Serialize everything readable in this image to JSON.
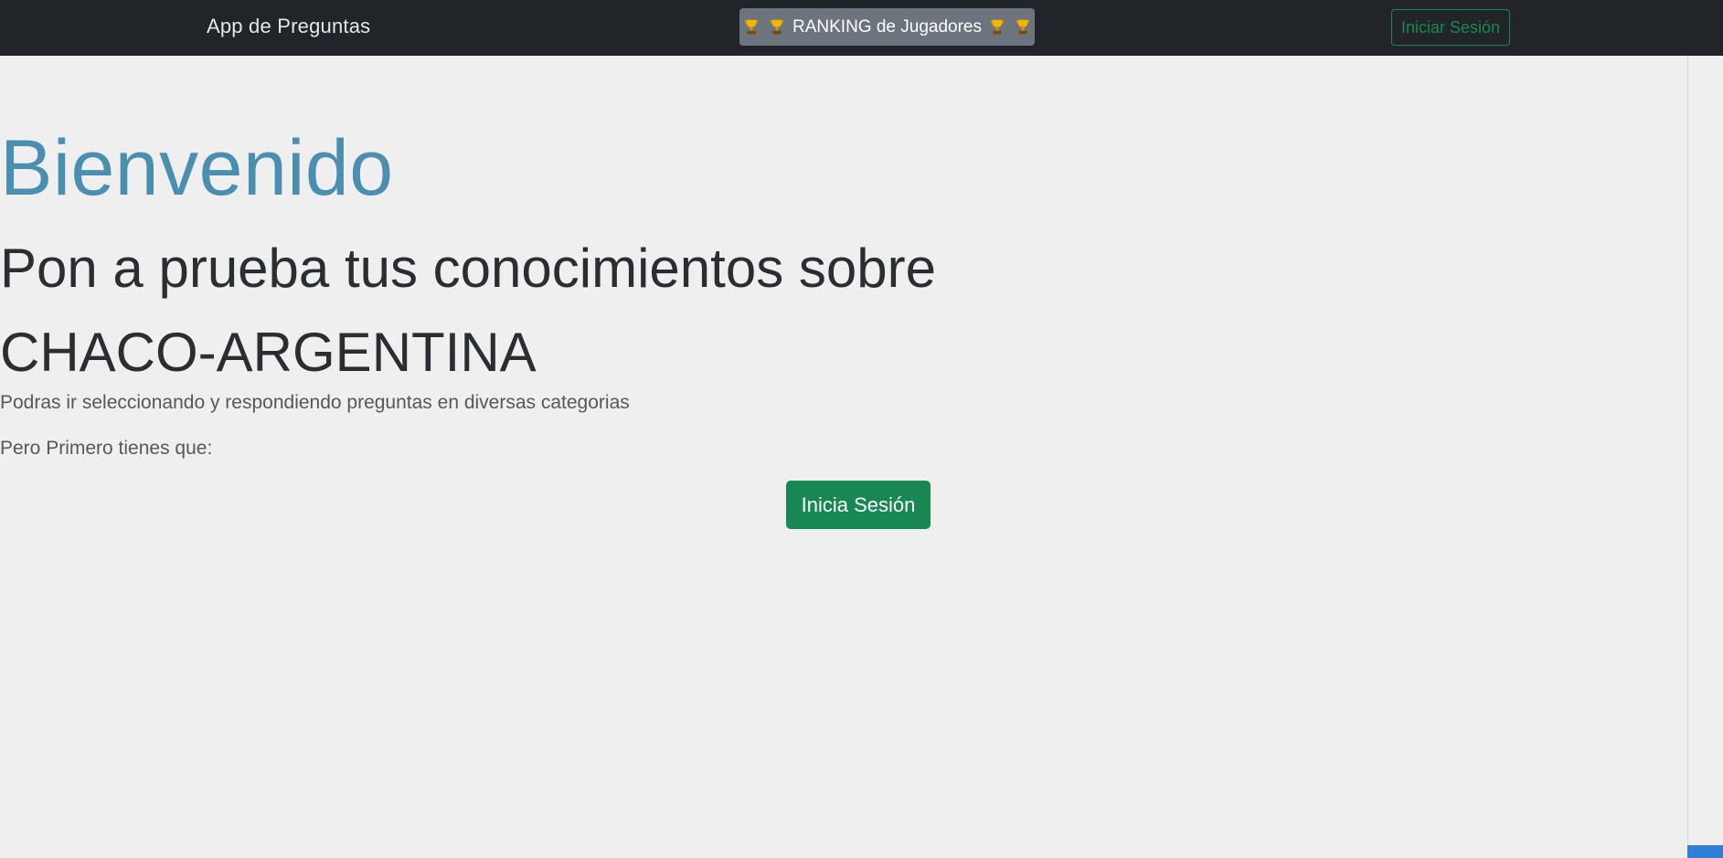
{
  "navbar": {
    "brand": "App de Preguntas",
    "ranking_label": "RANKING de Jugadores",
    "login_label": "Iniciar Sesión"
  },
  "hero": {
    "title": "Bienvenido",
    "subtitle_line1": "Pon a prueba tus conocimientos sobre",
    "subtitle_line2": "CHACO-ARGENTINA",
    "description": "Podras ir seleccionando y respondiendo preguntas en diversas categorias",
    "prompt": "Pero Primero tienes que:",
    "login_button": "Inicia Sesión"
  },
  "colors": {
    "navbar_bg": "#212529",
    "accent_green": "#198754",
    "title_blue": "#4a8fb0",
    "ranking_bg": "#6c757d",
    "page_bg": "#efefef"
  },
  "icons": {
    "ranking": [
      "trophy-icon",
      "trophy-icon",
      "trophy-icon",
      "trophy-icon"
    ]
  }
}
